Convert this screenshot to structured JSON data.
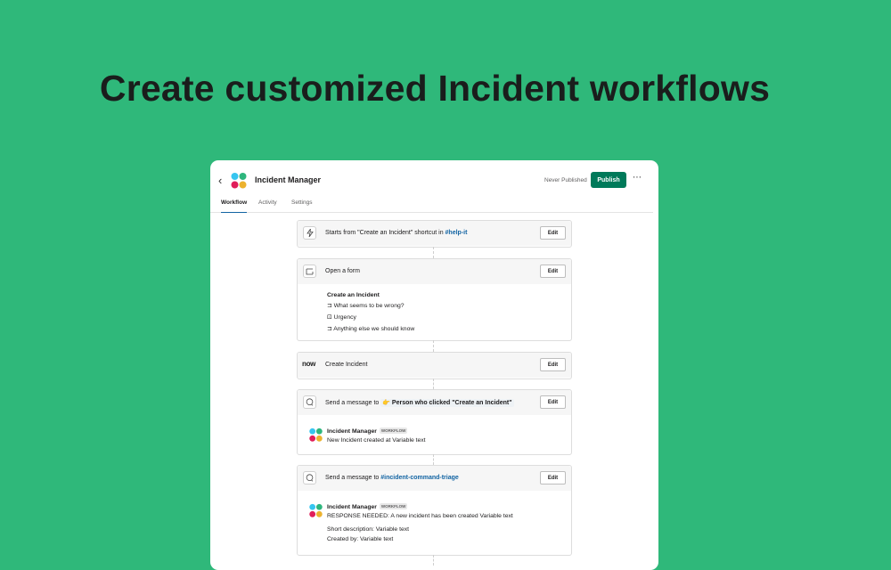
{
  "headline": "Create customized Incident workflows",
  "header": {
    "title": "Incident Manager",
    "status": "Never Published",
    "publish_label": "Publish",
    "more_label": "⋯",
    "back_label": "‹"
  },
  "tabs": [
    {
      "label": "Workflow",
      "active": true
    },
    {
      "label": "Activity",
      "active": false
    },
    {
      "label": "Settings",
      "active": false
    }
  ],
  "edit_label": "Edit",
  "steps": [
    {
      "icon": "lightning-icon",
      "pre": "Starts from \"Create an Incident\" shortcut in ",
      "link": "#help-it"
    },
    {
      "icon": "form-icon",
      "label": "Open a form",
      "form_title": "Create an Incident",
      "fields": [
        {
          "icon": "text-field-icon",
          "label": "What seems to be wrong?"
        },
        {
          "icon": "dropdown-field-icon",
          "label": "Urgency"
        },
        {
          "icon": "text-field-icon",
          "label": "Anything else we should know"
        }
      ]
    },
    {
      "icon": "servicenow-logo",
      "logo_text": "now",
      "label": "Create Incident"
    },
    {
      "icon": "message-icon",
      "pre": "Send a message to ",
      "chip": "👉 Person who clicked \"Create an Incident\"",
      "sender": "Incident Manager",
      "badge": "WORKFLOW",
      "message": "New Incident created at Variable text"
    },
    {
      "icon": "message-icon",
      "pre": "Send a message to ",
      "link": "#incident-command-triage",
      "sender": "Incident Manager",
      "badge": "WORKFLOW",
      "message": "RESPONSE NEEDED: A new incident has been created Variable text",
      "extra": [
        "Short description: Variable text",
        "Created by: Variable text"
      ]
    }
  ],
  "colors": {
    "background": "#2fb87a",
    "publish": "#007a5a",
    "link": "#1264a3"
  }
}
